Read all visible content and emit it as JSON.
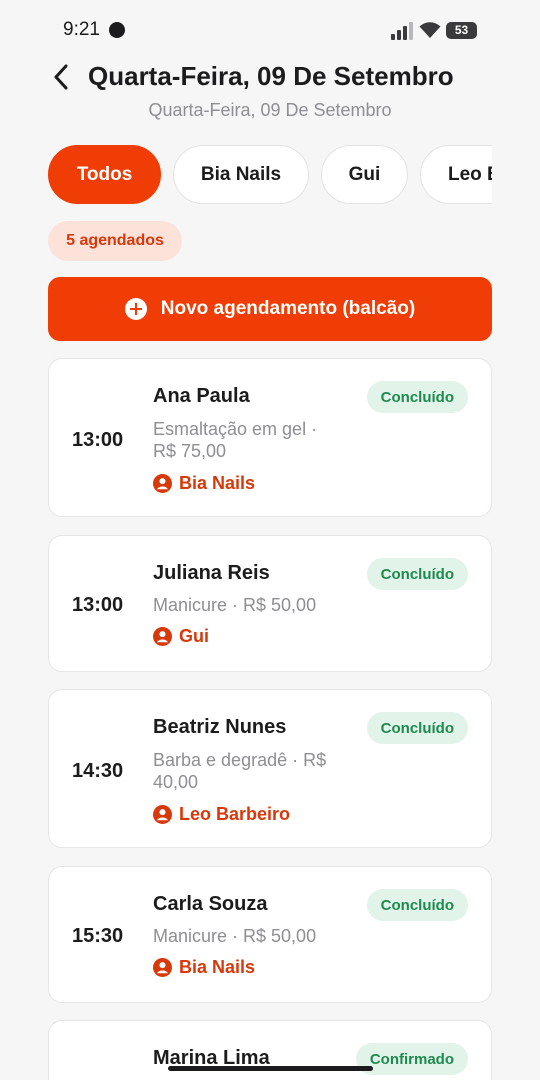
{
  "status_bar": {
    "time": "9:21",
    "battery": "53"
  },
  "header": {
    "title": "Quarta-Feira, 09 De Setembro",
    "subtitle": "Quarta-Feira, 09 De Setembro"
  },
  "filters": [
    {
      "label": "Todos",
      "active": true
    },
    {
      "label": "Bia Nails",
      "active": false
    },
    {
      "label": "Gui",
      "active": false
    },
    {
      "label": "Leo Barbeiro",
      "active": false
    }
  ],
  "count_badge": "5 agendados",
  "new_button": "Novo agendamento (balcão)",
  "appointments": [
    {
      "time": "13:00",
      "client": "Ana Paula",
      "service": "Esmaltação em gel · R$ 75,00",
      "professional": "Bia Nails",
      "status": "Concluído"
    },
    {
      "time": "13:00",
      "client": "Juliana Reis",
      "service": "Manicure · R$ 50,00",
      "professional": "Gui",
      "status": "Concluído"
    },
    {
      "time": "14:30",
      "client": "Beatriz Nunes",
      "service": "Barba e degradê · R$ 40,00",
      "professional": "Leo Barbeiro",
      "status": "Concluído"
    },
    {
      "time": "15:30",
      "client": "Carla Souza",
      "service": "Manicure · R$ 50,00",
      "professional": "Bia Nails",
      "status": "Concluído"
    },
    {
      "client": "Marina Lima",
      "status": "Confirmado"
    }
  ],
  "colors": {
    "accent": "#ef3d05",
    "success": "#1f8a50",
    "success_bg": "#e2f3ea",
    "muted": "#8e8e93"
  }
}
